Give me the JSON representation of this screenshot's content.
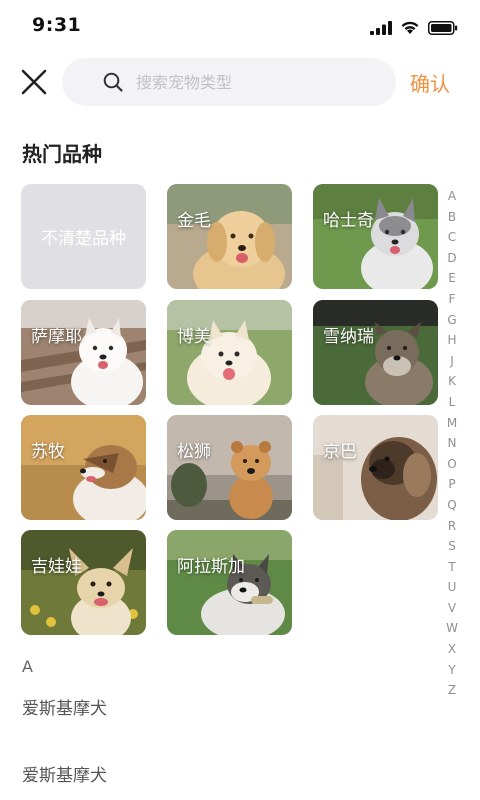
{
  "status_bar": {
    "time": "9:31",
    "icons": [
      "cellular-signal-icon",
      "wifi-icon",
      "battery-icon"
    ]
  },
  "header": {
    "close_icon": "close-icon",
    "search": {
      "placeholder": "搜索宠物类型",
      "value": "",
      "icon": "search-icon"
    },
    "confirm_label": "确认",
    "confirm_color": "#f0913e"
  },
  "popular": {
    "title": "热门品种",
    "tiles": [
      {
        "label": "不清楚品种"
      },
      {
        "label": "金毛"
      },
      {
        "label": "哈士奇"
      },
      {
        "label": "萨摩耶"
      },
      {
        "label": "博美"
      },
      {
        "label": "雪纳瑞"
      },
      {
        "label": "苏牧"
      },
      {
        "label": "松狮"
      },
      {
        "label": "京巴"
      },
      {
        "label": "吉娃娃"
      },
      {
        "label": "阿拉斯加"
      }
    ]
  },
  "alpha_index": [
    "A",
    "B",
    "C",
    "D",
    "E",
    "F",
    "G",
    "H",
    "J",
    "K",
    "L",
    "M",
    "N",
    "O",
    "P",
    "Q",
    "R",
    "S",
    "T",
    "U",
    "V",
    "W",
    "X",
    "Y",
    "Z"
  ],
  "list": {
    "section": "A",
    "items": [
      "爱斯基摩犬",
      "爱斯基摩犬"
    ]
  }
}
